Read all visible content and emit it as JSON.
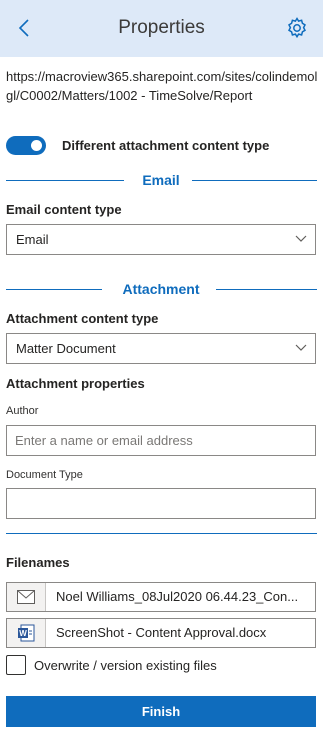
{
  "header": {
    "title": "Properties",
    "back_icon": "chevron-left-icon",
    "settings_icon": "gear-icon"
  },
  "location_url": "https://macroview365.sharepoint.com/sites/colindemolgl/C0002/Matters/1002 - TimeSolve/Report",
  "toggle": {
    "label": "Different attachment content type",
    "on": true
  },
  "email_section": {
    "title": "Email",
    "content_type_label": "Email content type",
    "content_type_value": "Email"
  },
  "attachment_section": {
    "title": "Attachment",
    "content_type_label": "Attachment content type",
    "content_type_value": "Matter Document",
    "properties_label": "Attachment properties",
    "author_label": "Author",
    "author_placeholder": "Enter a name or email address",
    "author_value": "",
    "doc_type_label": "Document Type",
    "doc_type_value": ""
  },
  "filenames": {
    "label": "Filenames",
    "items": [
      {
        "icon": "envelope-icon",
        "name": "Noel Williams_08Jul2020 06.44.23_Con..."
      },
      {
        "icon": "word-doc-icon",
        "name": "ScreenShot - Content Approval.docx"
      }
    ]
  },
  "overwrite": {
    "label": "Overwrite / version existing files",
    "checked": false
  },
  "finish_label": "Finish",
  "colors": {
    "accent": "#0f6cbd",
    "header_bg": "#dde9f8",
    "word_blue": "#2b579a"
  }
}
